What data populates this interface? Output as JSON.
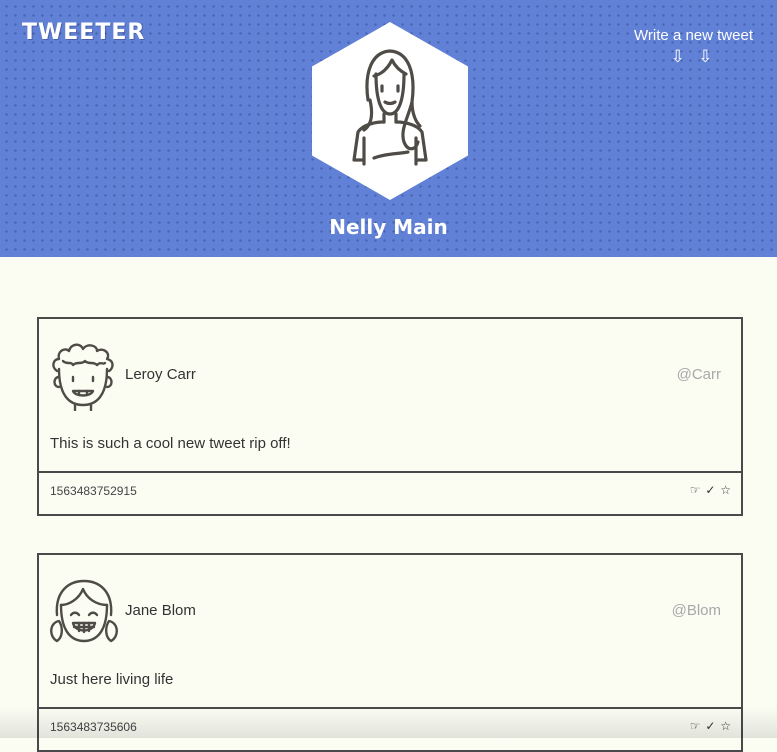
{
  "brand": "TWEETER",
  "compose": {
    "label": "Write a new tweet",
    "arrows": "⇩ ⇩"
  },
  "profile": {
    "name": "Nelly Main",
    "avatar_icon": "woman-long-hair-avatar"
  },
  "tweets": [
    {
      "name": "Leroy Carr",
      "handle": "@Carr",
      "avatar_icon": "curly-hair-man-avatar",
      "text": "This is such a cool new tweet rip off!",
      "timestamp": "1563483752915",
      "actions": {
        "flag": "☞",
        "retweet": "✓",
        "like": "☆"
      }
    },
    {
      "name": "Jane Blom",
      "handle": "@Blom",
      "avatar_icon": "pigtail-girl-avatar",
      "text": "Just here living life",
      "timestamp": "1563483735606",
      "actions": {
        "flag": "☞",
        "retweet": "✓",
        "like": "☆"
      }
    }
  ],
  "colors": {
    "header_bg": "#6181d6",
    "page_bg": "#fbfdf3",
    "border": "#4a4a4a",
    "handle": "#a8a8a8"
  }
}
